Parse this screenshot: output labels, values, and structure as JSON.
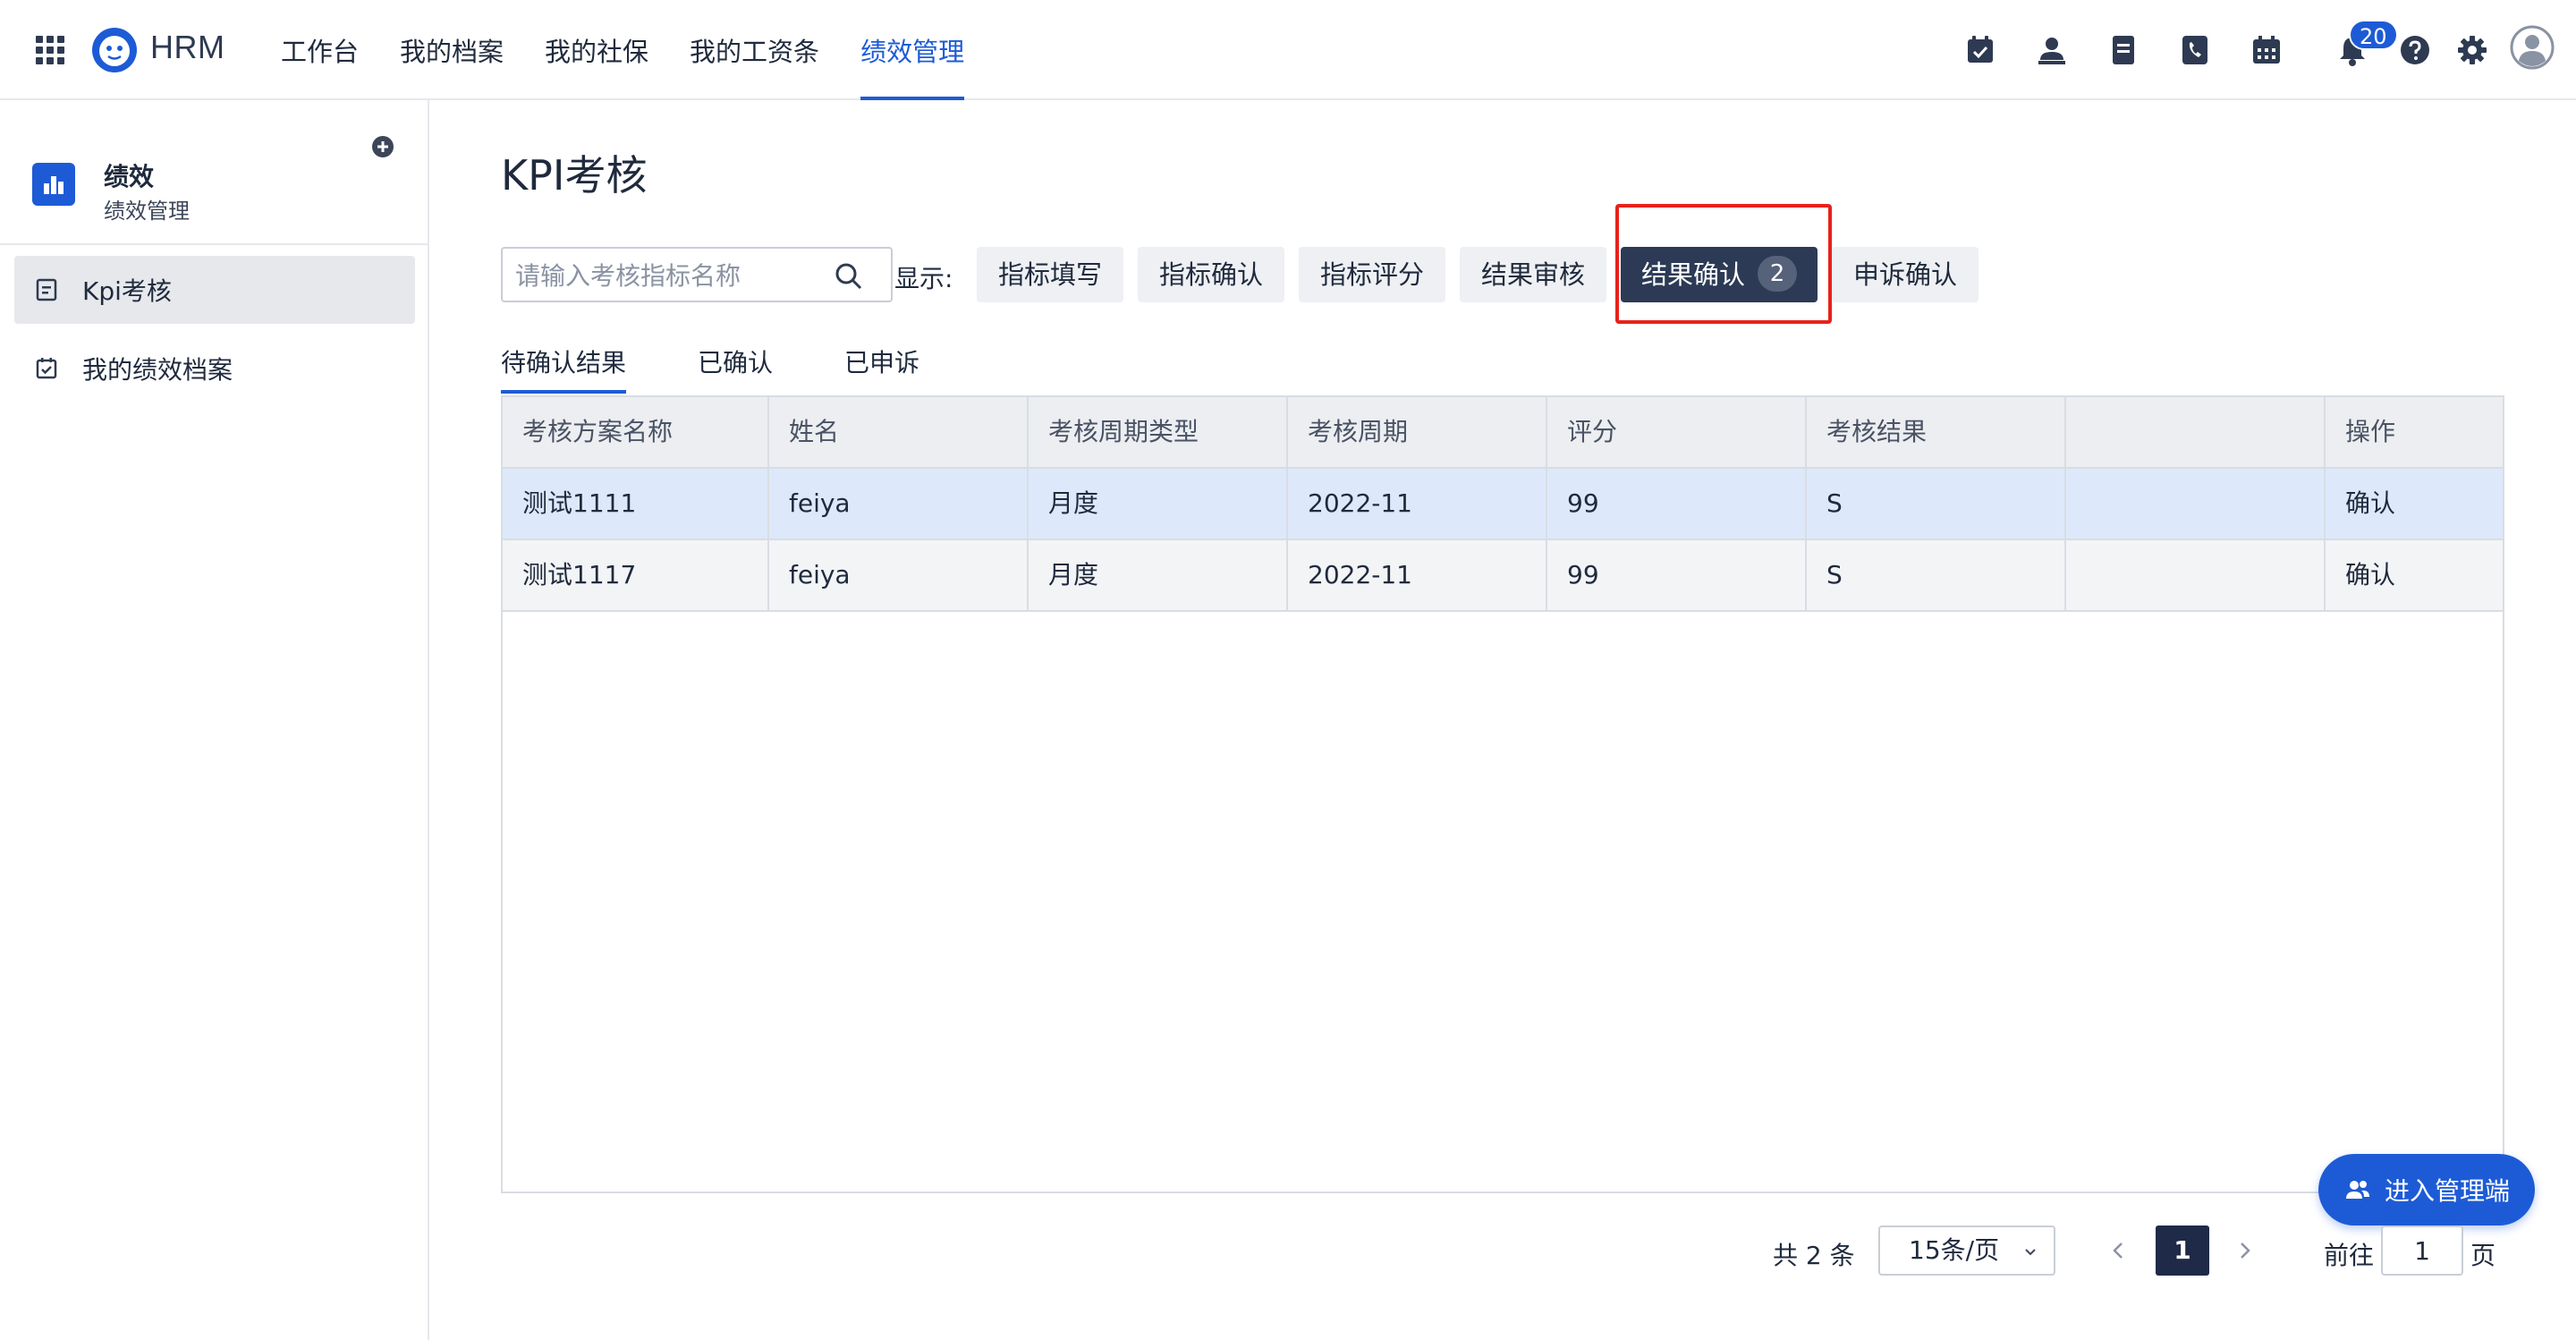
{
  "app": {
    "name": "HRM"
  },
  "nav": {
    "items": [
      {
        "label": "工作台",
        "active": false
      },
      {
        "label": "我的档案",
        "active": false
      },
      {
        "label": "我的社保",
        "active": false
      },
      {
        "label": "我的工资条",
        "active": false
      },
      {
        "label": "绩效管理",
        "active": true
      }
    ]
  },
  "toolbar": {
    "icons": [
      "calendar-check-icon",
      "user-icon",
      "document-icon",
      "phone-icon",
      "calendar-icon",
      "bell-icon",
      "help-icon",
      "gear-icon",
      "avatar-icon"
    ],
    "notification_count": "20"
  },
  "sidebar": {
    "title": "绩效",
    "subtitle": "绩效管理",
    "items": [
      {
        "label": "Kpi考核",
        "icon": "list-doc-icon",
        "active": true
      },
      {
        "label": "我的绩效档案",
        "icon": "calendar-check-icon",
        "active": false
      }
    ]
  },
  "main": {
    "page_title": "KPI考核",
    "search_placeholder": "请输入考核指标名称",
    "show_label": "显示:",
    "filters": [
      {
        "label": "指标填写"
      },
      {
        "label": "指标确认"
      },
      {
        "label": "指标评分"
      },
      {
        "label": "结果审核"
      },
      {
        "label": "结果确认",
        "count": "2",
        "active": true
      },
      {
        "label": "申诉确认"
      }
    ],
    "subtabs": [
      {
        "label": "待确认结果",
        "active": true
      },
      {
        "label": "已确认"
      },
      {
        "label": "已申诉"
      }
    ]
  },
  "table": {
    "columns": [
      "考核方案名称",
      "姓名",
      "考核周期类型",
      "考核周期",
      "评分",
      "考核结果",
      "",
      "操作"
    ],
    "rows": [
      [
        "测试1111",
        "feiya",
        "月度",
        "2022-11",
        "99",
        "S",
        "",
        "确认"
      ],
      [
        "测试1117",
        "feiya",
        "月度",
        "2022-11",
        "99",
        "S",
        "",
        "确认"
      ]
    ]
  },
  "admin_button": {
    "label": "进入管理端"
  },
  "pagination": {
    "total": "共 2 条",
    "page_size": "15条/页",
    "current_page": "1",
    "goto_label": "前往",
    "goto_value": "1",
    "page_suffix": "页"
  },
  "colors": {
    "accent": "#1d5bd6",
    "dark_button": "#2c3a56",
    "highlight": "#e8211b",
    "selected_row": "#dde9fb"
  }
}
